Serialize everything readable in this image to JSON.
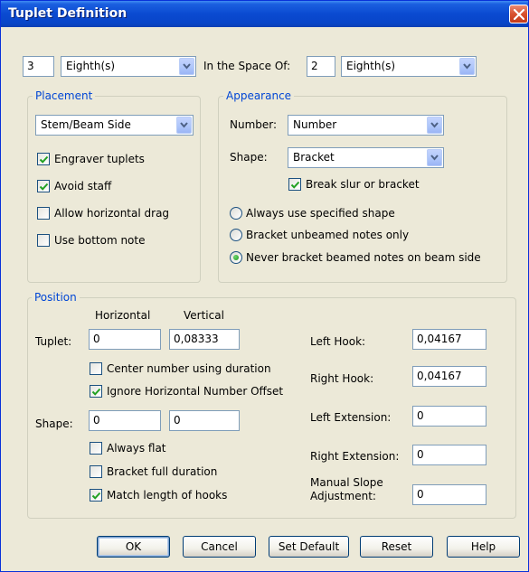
{
  "window": {
    "title": "Tuplet Definition",
    "accent": "#0a4ad1"
  },
  "top_row": {
    "count": "3",
    "unit_1": "Eighth(s)",
    "in_space_of_label": "In the Space Of:",
    "space_count": "2",
    "unit_2": "Eighth(s)"
  },
  "placement": {
    "title": "Placement",
    "placement_select": "Stem/Beam Side",
    "engraver_tuplets": {
      "label": "Engraver tuplets",
      "checked": true
    },
    "avoid_staff": {
      "label": "Avoid staff",
      "checked": true
    },
    "allow_horizontal_drag": {
      "label": "Allow horizontal drag",
      "checked": false
    },
    "use_bottom_note": {
      "label": "Use bottom note",
      "checked": false
    }
  },
  "appearance": {
    "title": "Appearance",
    "number_label": "Number:",
    "number_value": "Number",
    "shape_label": "Shape:",
    "shape_value": "Bracket",
    "break_slur": {
      "label": "Break slur or bracket",
      "checked": true
    },
    "radio_always": {
      "label": "Always use specified shape",
      "selected": false
    },
    "radio_unbeamed": {
      "label": "Bracket unbeamed notes only",
      "selected": false
    },
    "radio_never": {
      "label": "Never bracket beamed notes on beam side",
      "selected": true
    }
  },
  "position": {
    "title": "Position",
    "horizontal_header": "Horizontal",
    "vertical_header": "Vertical",
    "tuplet_label": "Tuplet:",
    "tuplet_horizontal": "0",
    "tuplet_vertical": "0,08333",
    "center_number": {
      "label": "Center number using duration",
      "checked": false
    },
    "ignore_offset": {
      "label": "Ignore Horizontal Number Offset",
      "checked": true
    },
    "shape_label": "Shape:",
    "shape_horizontal": "0",
    "shape_vertical": "0",
    "always_flat": {
      "label": "Always flat",
      "checked": false
    },
    "bracket_full": {
      "label": "Bracket full duration",
      "checked": false
    },
    "match_hooks": {
      "label": "Match length of hooks",
      "checked": true
    },
    "left_hook_label": "Left Hook:",
    "left_hook": "0,04167",
    "right_hook_label": "Right Hook:",
    "right_hook": "0,04167",
    "left_extension_label": "Left Extension:",
    "left_extension": "0",
    "right_extension_label": "Right Extension:",
    "right_extension": "0",
    "manual_slope_label_1": "Manual Slope",
    "manual_slope_label_2": "Adjustment:",
    "manual_slope": "0"
  },
  "buttons": {
    "ok": "OK",
    "cancel": "Cancel",
    "set_default": "Set Default",
    "reset": "Reset",
    "help": "Help"
  }
}
